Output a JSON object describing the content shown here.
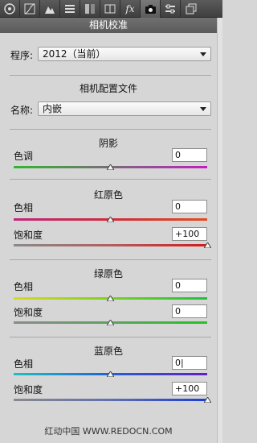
{
  "tabs": [
    {
      "icon": "aperture-icon"
    },
    {
      "icon": "curve-icon"
    },
    {
      "icon": "mountain-icon"
    },
    {
      "icon": "list-icon"
    },
    {
      "icon": "gray-bars-icon"
    },
    {
      "icon": "split-icon"
    },
    {
      "icon": "fx-icon",
      "label": "fx"
    },
    {
      "icon": "camera-icon"
    },
    {
      "icon": "sliders-icon"
    },
    {
      "icon": "copy-icon"
    }
  ],
  "panel_title": "相机校准",
  "process": {
    "label": "程序:",
    "value": "2012（当前）"
  },
  "profile_section": "相机配置文件",
  "profile": {
    "label": "名称:",
    "value": "内嵌"
  },
  "shadows": {
    "title": "阴影",
    "tint": {
      "label": "色调",
      "value": "0",
      "level": 0.5
    }
  },
  "red": {
    "title": "红原色",
    "hue": {
      "label": "色相",
      "value": "0",
      "level": 0.5
    },
    "sat": {
      "label": "饱和度",
      "value": "+100",
      "level": 1.0
    }
  },
  "green": {
    "title": "绿原色",
    "hue": {
      "label": "色相",
      "value": "0",
      "level": 0.5
    },
    "sat": {
      "label": "饱和度",
      "value": "0",
      "level": 0.5
    }
  },
  "blue": {
    "title": "蓝原色",
    "hue": {
      "label": "色相",
      "value": "0|",
      "level": 0.5
    },
    "sat": {
      "label": "饱和度",
      "value": "+100",
      "level": 1.0
    }
  },
  "watermark": "红动中国 WWW.REDOCN.COM",
  "colors": {
    "green_track": "#2fb82f",
    "magenta_track": "#c21ec2"
  }
}
